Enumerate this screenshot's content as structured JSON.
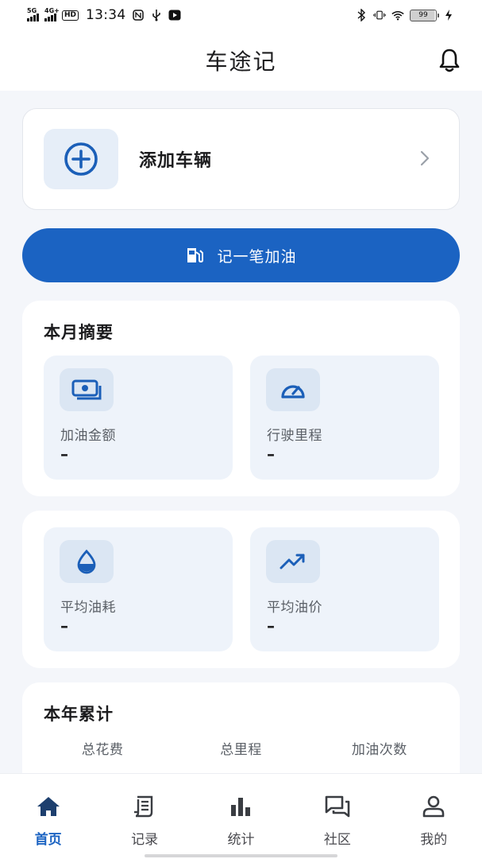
{
  "status_bar": {
    "sig1_label": "5G",
    "sig2_label": "4G+",
    "hd_label": "HD",
    "time": "13:34",
    "battery_level": "99"
  },
  "header": {
    "title": "车途记"
  },
  "vehicle_card": {
    "label": "添加车辆"
  },
  "fuel_button": {
    "label": "记一笔加油"
  },
  "month_summary": {
    "title": "本月摘要",
    "tiles": [
      {
        "label": "加油金额",
        "value": "–",
        "icon": "money-icon"
      },
      {
        "label": "行驶里程",
        "value": "–",
        "icon": "speedometer-icon"
      }
    ]
  },
  "averages": {
    "tiles": [
      {
        "label": "平均油耗",
        "value": "–",
        "icon": "fuel-drop-icon"
      },
      {
        "label": "平均油价",
        "value": "–",
        "icon": "trend-up-icon"
      }
    ]
  },
  "year_total": {
    "title": "本年累计",
    "columns": [
      {
        "label": "总花费",
        "value": "–"
      },
      {
        "label": "总里程",
        "value": "–"
      },
      {
        "label": "加油次数",
        "value": "–"
      }
    ]
  },
  "bottom_nav": {
    "items": [
      {
        "label": "首页",
        "icon": "home-icon",
        "active": true
      },
      {
        "label": "记录",
        "icon": "receipt-icon",
        "active": false
      },
      {
        "label": "统计",
        "icon": "bar-chart-icon",
        "active": false
      },
      {
        "label": "社区",
        "icon": "chat-icon",
        "active": false
      },
      {
        "label": "我的",
        "icon": "user-icon",
        "active": false
      }
    ]
  },
  "colors": {
    "primary": "#1b63c2",
    "background": "#f4f6fa",
    "tile_background": "#eef3fa"
  }
}
